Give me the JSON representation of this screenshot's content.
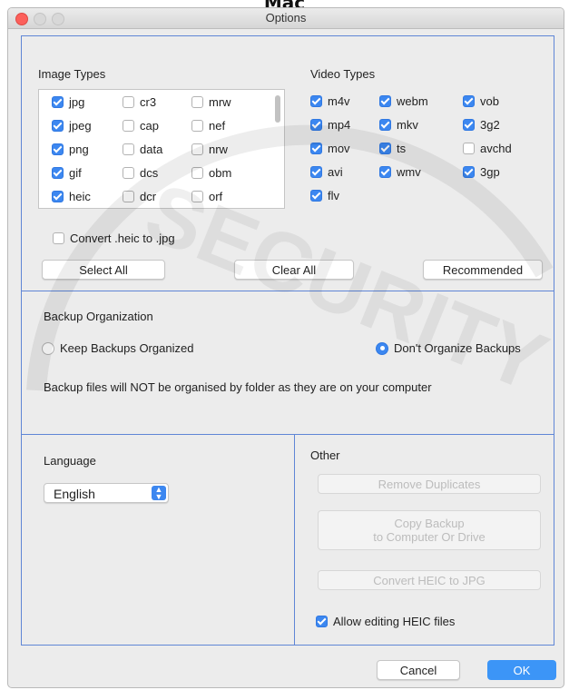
{
  "page_caption": "Mac",
  "window": {
    "title": "Options"
  },
  "image_types": {
    "heading": "Image Types",
    "items": [
      {
        "label": "jpg",
        "checked": true
      },
      {
        "label": "cr3",
        "checked": false
      },
      {
        "label": "mrw",
        "checked": false
      },
      {
        "label": "jpeg",
        "checked": true
      },
      {
        "label": "cap",
        "checked": false
      },
      {
        "label": "nef",
        "checked": false
      },
      {
        "label": "png",
        "checked": true
      },
      {
        "label": "data",
        "checked": false
      },
      {
        "label": "nrw",
        "checked": false
      },
      {
        "label": "gif",
        "checked": true
      },
      {
        "label": "dcs",
        "checked": false
      },
      {
        "label": "obm",
        "checked": false
      },
      {
        "label": "heic",
        "checked": true
      },
      {
        "label": "dcr",
        "checked": false
      },
      {
        "label": "orf",
        "checked": false
      }
    ],
    "convert_label": "Convert .heic to .jpg",
    "convert_checked": false
  },
  "video_types": {
    "heading": "Video Types",
    "items": [
      {
        "label": "m4v",
        "checked": true
      },
      {
        "label": "webm",
        "checked": true
      },
      {
        "label": "vob",
        "checked": true
      },
      {
        "label": "mp4",
        "checked": true
      },
      {
        "label": "mkv",
        "checked": true
      },
      {
        "label": "3g2",
        "checked": true
      },
      {
        "label": "mov",
        "checked": true
      },
      {
        "label": "ts",
        "checked": true
      },
      {
        "label": "avchd",
        "checked": false
      },
      {
        "label": "avi",
        "checked": true
      },
      {
        "label": "wmv",
        "checked": true
      },
      {
        "label": "3gp",
        "checked": true
      },
      {
        "label": "flv",
        "checked": true
      }
    ]
  },
  "buttons": {
    "select_all": "Select All",
    "clear_all": "Clear All",
    "recommended": "Recommended"
  },
  "backup": {
    "heading": "Backup Organization",
    "keep_label": "Keep Backups Organized",
    "dont_label": "Don't Organize Backups",
    "selected": "dont",
    "description": "Backup files will NOT be organised by folder as they are on your computer"
  },
  "language": {
    "heading": "Language",
    "value": "English"
  },
  "other": {
    "heading": "Other",
    "remove_duplicates": "Remove Duplicates",
    "copy_backup_line1": "Copy Backup",
    "copy_backup_line2": "to Computer Or Drive",
    "convert_heic": "Convert HEIC to JPG",
    "allow_editing_label": "Allow editing HEIC files",
    "allow_editing_checked": true
  },
  "footer": {
    "cancel": "Cancel",
    "ok": "OK"
  },
  "colors": {
    "accent": "#3c87f0",
    "divider": "#5f86d6",
    "ok_button": "#3c95f7"
  },
  "watermark_text": "SECURITY"
}
